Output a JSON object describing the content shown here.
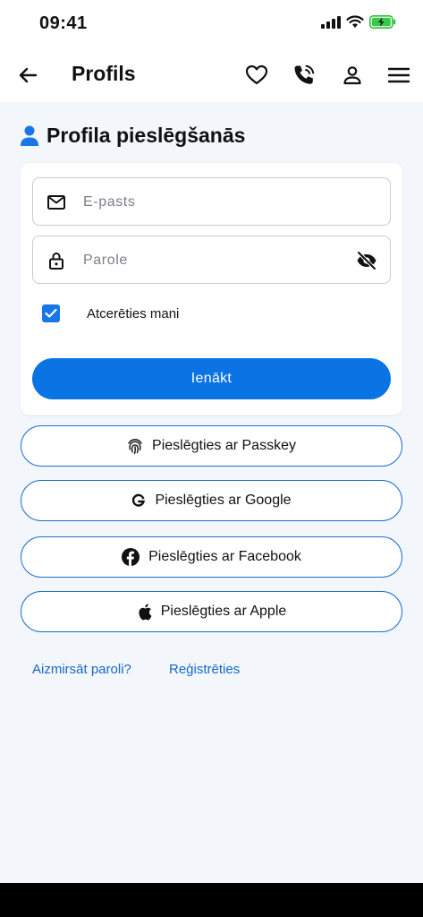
{
  "status_bar": {
    "time": "09:41"
  },
  "header": {
    "title": "Profils",
    "icons": [
      "arrow-left-icon",
      "heart-icon",
      "phone-icon",
      "user-icon",
      "menu-icon"
    ]
  },
  "section": {
    "title": "Profila pieslēgšanās",
    "icon": "user-icon"
  },
  "form": {
    "email_placeholder": "E-pasts",
    "password_placeholder": "Parole",
    "remember_label": "Atcerēties mani",
    "remember_checked": true,
    "submit_label": "Ienākt"
  },
  "social": {
    "passkey_label": "Pieslēgties ar Passkey",
    "google_label": "Pieslēgties ar Google",
    "facebook_label": "Pieslēgties ar Facebook",
    "apple_label": "Pieslēgties ar Apple"
  },
  "links": {
    "forgot_password": "Aizmirsāt paroli?",
    "register": "Reģistrēties"
  },
  "colors": {
    "primary": "#0a74e4",
    "link": "#1566c9",
    "background": "#f3f7fb"
  }
}
